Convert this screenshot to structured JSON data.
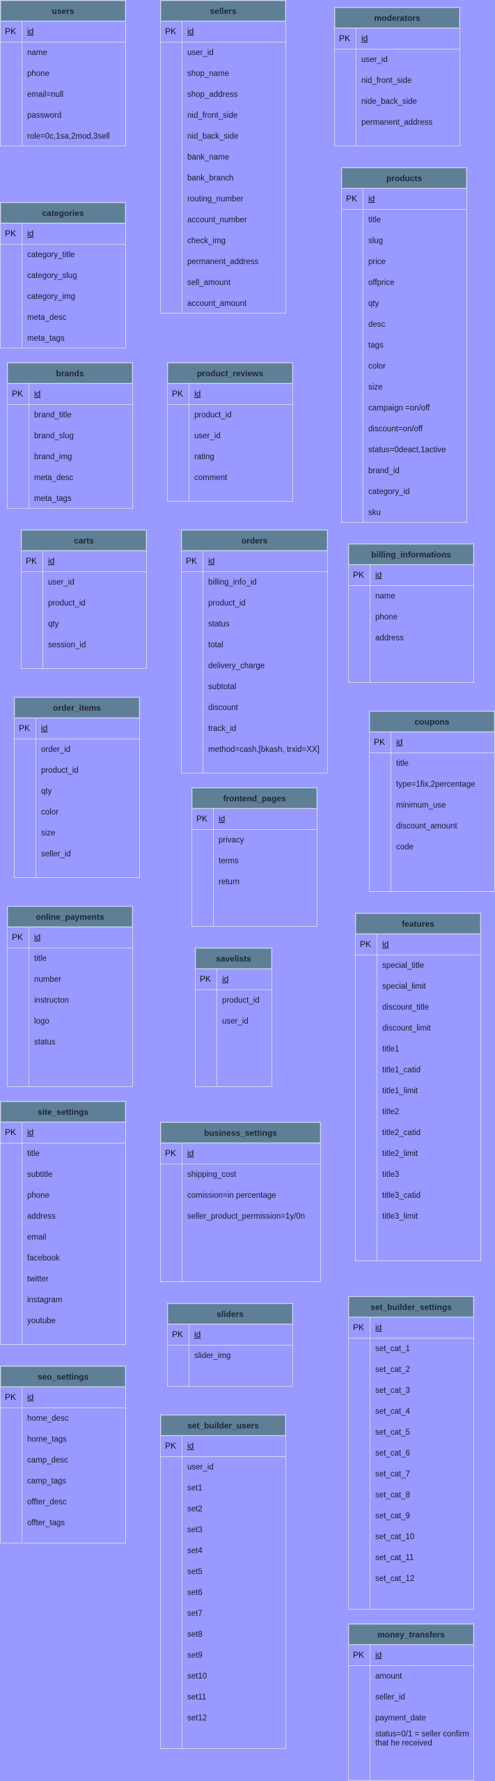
{
  "pk_label": "PK",
  "tables": [
    {
      "key": "users",
      "name": "users",
      "fields": [
        "name",
        "phone",
        "email=null",
        "password",
        "role=0c,1sa,2mod,3sell"
      ]
    },
    {
      "key": "sellers",
      "name": "sellers",
      "fields": [
        "user_id",
        "shop_name",
        "shop_address",
        "nid_front_side",
        "nid_back_side",
        "bank_name",
        "bank_branch",
        "routing_number",
        "account_number",
        "check_img",
        "permanent_address",
        "sell_amount",
        "account_amount"
      ]
    },
    {
      "key": "moderators",
      "name": "moderators",
      "fields": [
        "user_id",
        "nid_front_side",
        "nide_back_side",
        "permanent_address"
      ]
    },
    {
      "key": "products",
      "name": "products",
      "fields": [
        "title",
        "slug",
        "price",
        "offprice",
        "qty",
        "desc",
        "tags",
        "color",
        "size",
        "campaign =on/off",
        "discount=on/off",
        "status=0deact,1active",
        "brand_id",
        "category_id",
        "sku"
      ]
    },
    {
      "key": "categories",
      "name": "categories",
      "fields": [
        "category_title",
        "category_slug",
        "category_img",
        "meta_desc",
        "meta_tags"
      ]
    },
    {
      "key": "brands",
      "name": "brands",
      "fields": [
        "brand_title",
        "brand_slug",
        "brand_img",
        "meta_desc",
        "meta_tags"
      ]
    },
    {
      "key": "product_reviews",
      "name": "product_reviews",
      "fields": [
        "product_id",
        "user_id",
        "rating",
        "comment"
      ]
    },
    {
      "key": "carts",
      "name": "carts",
      "fields": [
        "user_id",
        "product_id",
        "qty",
        "session_id"
      ]
    },
    {
      "key": "orders",
      "name": "orders",
      "fields": [
        "billing_info_id",
        "product_id",
        "status",
        "total",
        "delivery_charge",
        "subtotal",
        "discount",
        "track_id",
        "method=cash,[bkash, trxid=XX]"
      ]
    },
    {
      "key": "billing_informations",
      "name": "billing_informations",
      "fields": [
        "name",
        "phone",
        "address"
      ]
    },
    {
      "key": "order_items",
      "name": "order_items",
      "fields": [
        "order_id",
        "product_id",
        "qty",
        "color",
        "size",
        "seller_id"
      ]
    },
    {
      "key": "coupons",
      "name": "coupons",
      "fields": [
        "title",
        "type=1fix,2percentage",
        "minimum_use",
        "discount_amount",
        "code"
      ]
    },
    {
      "key": "frontend_pages",
      "name": "frontend_pages",
      "fields": [
        "privacy",
        "terms",
        "return"
      ]
    },
    {
      "key": "online_payments",
      "name": "online_payments",
      "fields": [
        "title",
        "number",
        "instructon",
        "logo",
        "status"
      ]
    },
    {
      "key": "savelists",
      "name": "savelists",
      "fields": [
        "product_id",
        "user_id"
      ]
    },
    {
      "key": "features",
      "name": "features",
      "fields": [
        "special_title",
        "special_limit",
        "discount_title",
        "discount_limit",
        "title1",
        "title1_catid",
        "title1_limit",
        "title2",
        "title2_catid",
        "title2_limit",
        "title3",
        "title3_catid",
        "title3_limit"
      ]
    },
    {
      "key": "site_settings",
      "name": "site_settings",
      "fields": [
        "title",
        "subtitle",
        "phone",
        "address",
        "email",
        "facebook",
        "twitter",
        "instagram",
        "youtube"
      ]
    },
    {
      "key": "business_settings",
      "name": "business_settings",
      "fields": [
        "shipping_cost",
        "comission=in percentage",
        "seller_product_permission=1y/0n"
      ]
    },
    {
      "key": "sliders",
      "name": "sliders",
      "fields": [
        "slider_img"
      ]
    },
    {
      "key": "set_builder_settings",
      "name": "set_builder_settings",
      "fields": [
        "set_cat_1",
        "set_cat_2",
        "set_cat_3",
        "set_cat_4",
        "set_cat_5",
        "set_cat_6",
        "set_cat_7",
        "set_cat_8",
        "set_cat_9",
        "set_cat_10",
        "set_cat_11",
        "set_cat_12"
      ]
    },
    {
      "key": "seo_settings",
      "name": "seo_settings",
      "fields": [
        "home_desc",
        "home_tags",
        "camp_desc",
        "camp_tags",
        "offter_desc",
        "offter_tags"
      ]
    },
    {
      "key": "set_builder_users",
      "name": "set_builder_users",
      "fields": [
        "user_id",
        "set1",
        "set2",
        "set3",
        "set4",
        "set5",
        "set6",
        "set7",
        "set8",
        "set9",
        "set10",
        "set11",
        "set12"
      ]
    },
    {
      "key": "money_transfers",
      "name": "money_transfers",
      "fields": [
        "amount",
        "seller_id",
        "payment_date",
        "status=0/1 = seller confirm that he received"
      ]
    }
  ],
  "pk_field": "id"
}
